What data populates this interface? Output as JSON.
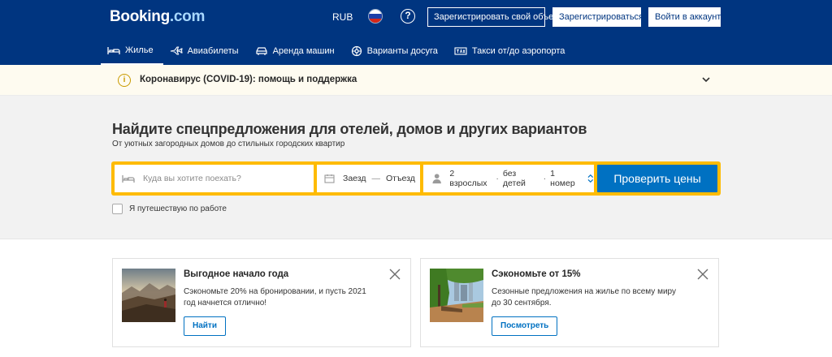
{
  "header": {
    "logo_main": "Booking",
    "logo_suffix": ".com",
    "currency": "RUB",
    "help_icon": "?",
    "list_property_label": "Зарегистрировать свой объект",
    "register_label": "Зарегистрироваться",
    "signin_label": "Войти в аккаунт"
  },
  "nav": {
    "items": [
      {
        "label": "Жилье",
        "icon": "bed-icon",
        "active": true
      },
      {
        "label": "Авиабилеты",
        "icon": "plane-icon"
      },
      {
        "label": "Аренда машин",
        "icon": "car-icon"
      },
      {
        "label": "Варианты досуга",
        "icon": "attractions-icon"
      },
      {
        "label": "Такси от/до аэропорта",
        "icon": "taxi-icon"
      }
    ]
  },
  "covid": {
    "icon": "i",
    "text": "Коронавирус (COVID-19): помощь и поддержка"
  },
  "search": {
    "title": "Найдите спецпредложения для отелей, домов и других вариантов",
    "subtitle": "От уютных загородных домов до стильных городских квартир",
    "destination_placeholder": "Куда вы хотите поехать?",
    "checkin": "Заезд",
    "date_separator": "—",
    "checkout": "Отъезд",
    "adults": "2 взрослых",
    "dot": "·",
    "children": "без детей",
    "rooms": "1 номер",
    "submit_label": "Проверить цены",
    "work_travel_label": "Я путешествую по работе"
  },
  "promos": [
    {
      "title": "Выгодное начало года",
      "description": "Сэкономьте 20% на бронировании, и пусть 2021 год начнется отлично!",
      "button": "Найти"
    },
    {
      "title": "Сэкономьте от 15%",
      "description": "Сезонные предложения на жилье по всему миру до 30 сентября.",
      "button": "Посмотреть"
    }
  ],
  "colors": {
    "brand_blue": "#003580",
    "action_blue": "#0071c2",
    "search_yellow": "#febb02"
  }
}
